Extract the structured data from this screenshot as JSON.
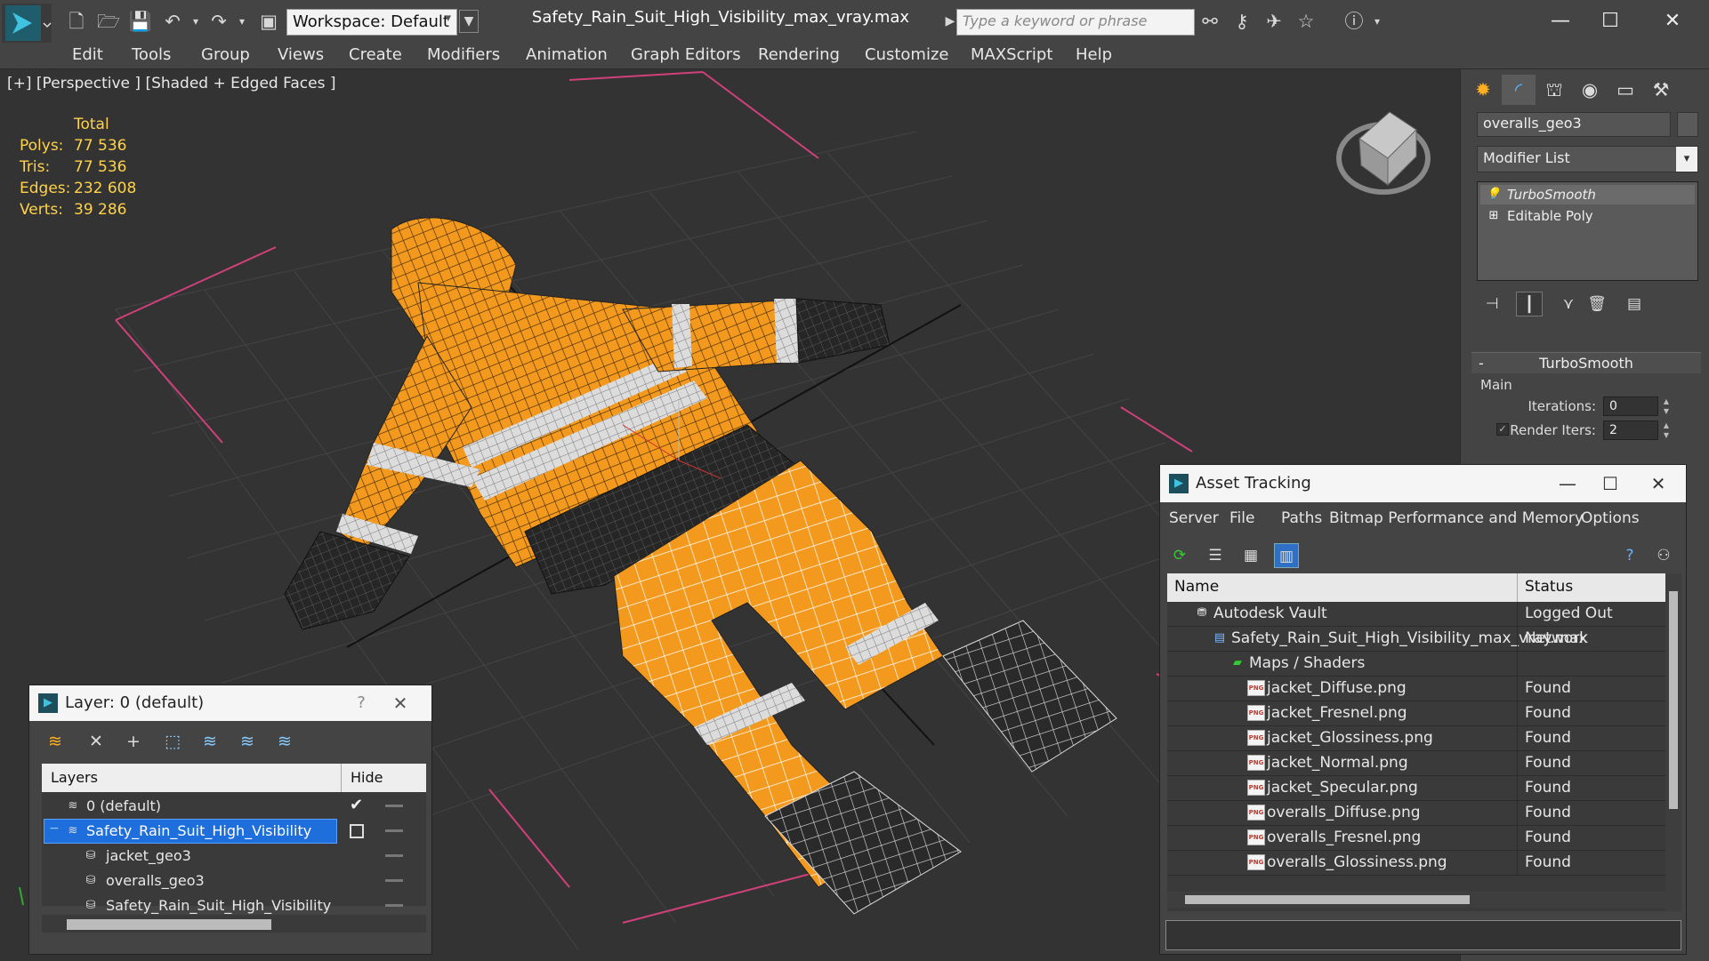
{
  "titlebar": {
    "workspace": "Workspace: Default",
    "file_title": "Safety_Rain_Suit_High_Visibility_max_vray.max",
    "search_placeholder": "Type a keyword or phrase"
  },
  "menu": [
    "Edit",
    "Tools",
    "Group",
    "Views",
    "Create",
    "Modifiers",
    "Animation",
    "Graph Editors",
    "Rendering",
    "Customize",
    "MAXScript",
    "Help"
  ],
  "viewport": {
    "label": "[+] [Perspective ] [Shaded + Edged Faces ]",
    "stats_header": "Total",
    "stats": [
      {
        "k": "Polys:",
        "v": "77 536"
      },
      {
        "k": "Tris:",
        "v": "77 536"
      },
      {
        "k": "Edges:",
        "v": "232 608"
      },
      {
        "k": "Verts:",
        "v": "39 286"
      }
    ]
  },
  "command_panel": {
    "object_name": "overalls_geo3",
    "modifier_list": "Modifier List",
    "stack": [
      "TurboSmooth",
      "Editable Poly"
    ],
    "rollout_title": "TurboSmooth",
    "group_main": "Main",
    "iterations_label": "Iterations:",
    "iterations_value": "0",
    "render_iters_label": "Render Iters:",
    "render_iters_value": "2",
    "render_iters_checked": true
  },
  "asset_tracking": {
    "title": "Asset Tracking",
    "menu": [
      "Server",
      "File",
      "Paths",
      "Bitmap Performance and Memory",
      "Options"
    ],
    "col_name": "Name",
    "col_status": "Status",
    "rows": [
      {
        "name": "Autodesk Vault",
        "status": "Logged Out",
        "indent": 1,
        "icon": "vault"
      },
      {
        "name": "Safety_Rain_Suit_High_Visibility_max_vray.max",
        "status": "Network",
        "indent": 2,
        "icon": "max"
      },
      {
        "name": "Maps / Shaders",
        "status": "",
        "indent": 3,
        "icon": "maps"
      },
      {
        "name": "jacket_Diffuse.png",
        "status": "Found",
        "indent": 4,
        "icon": "png"
      },
      {
        "name": "jacket_Fresnel.png",
        "status": "Found",
        "indent": 4,
        "icon": "png"
      },
      {
        "name": "jacket_Glossiness.png",
        "status": "Found",
        "indent": 4,
        "icon": "png"
      },
      {
        "name": "jacket_Normal.png",
        "status": "Found",
        "indent": 4,
        "icon": "png"
      },
      {
        "name": "jacket_Specular.png",
        "status": "Found",
        "indent": 4,
        "icon": "png"
      },
      {
        "name": "overalls_Diffuse.png",
        "status": "Found",
        "indent": 4,
        "icon": "png"
      },
      {
        "name": "overalls_Fresnel.png",
        "status": "Found",
        "indent": 4,
        "icon": "png"
      },
      {
        "name": "overalls_Glossiness.png",
        "status": "Found",
        "indent": 4,
        "icon": "png"
      }
    ]
  },
  "layer_explorer": {
    "title": "Layer: 0 (default)",
    "help": "?",
    "col_layers": "Layers",
    "col_hide": "Hide",
    "rows": [
      {
        "name": "0 (default)",
        "indent": 1,
        "type": "layer",
        "current": true
      },
      {
        "name": "Safety_Rain_Suit_High_Visibility",
        "indent": 1,
        "type": "layer",
        "selected": true,
        "expand": "−"
      },
      {
        "name": "jacket_geo3",
        "indent": 2,
        "type": "object"
      },
      {
        "name": "overalls_geo3",
        "indent": 2,
        "type": "object"
      },
      {
        "name": "Safety_Rain_Suit_High_Visibility",
        "indent": 2,
        "type": "object"
      }
    ]
  },
  "colors": {
    "ui_bg": "#444444",
    "viewport_bg": "#333333",
    "stats_yellow": "#ffd24a",
    "suit_orange": "#f39a1e",
    "suit_dark": "#2a2a2a",
    "reflective": "#d8d8d8",
    "selection_blue": "#1e6fdc",
    "grid_pink": "#d0407a"
  }
}
